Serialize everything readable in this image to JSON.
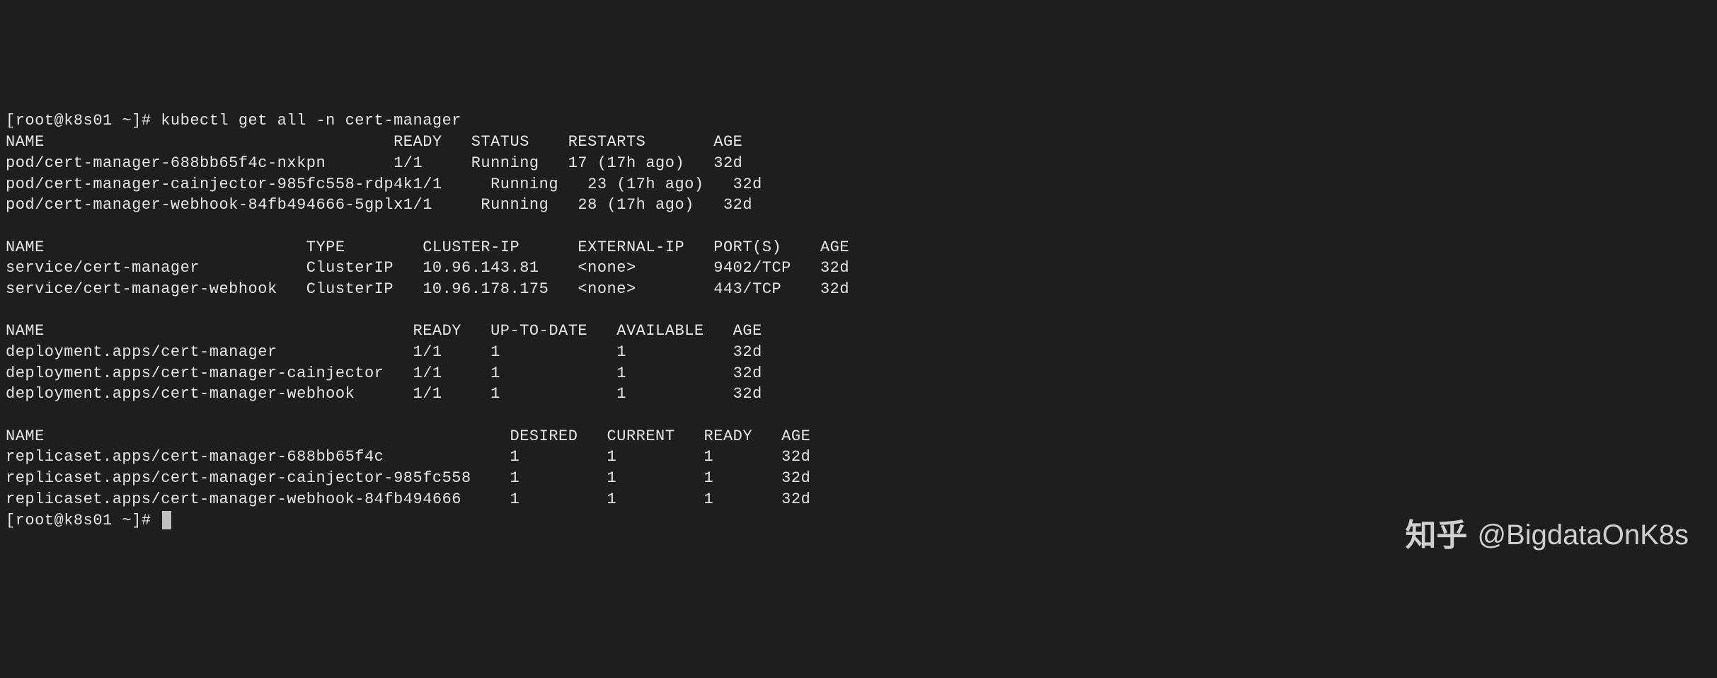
{
  "prompt1": "[root@k8s01 ~]# ",
  "command": "kubectl get all -n cert-manager",
  "pods": {
    "header": {
      "name": "NAME",
      "ready": "READY",
      "status": "STATUS",
      "restarts": "RESTARTS",
      "age": "AGE"
    },
    "rows": [
      {
        "name": "pod/cert-manager-688bb65f4c-nxkpn",
        "ready": "1/1",
        "status": "Running",
        "restarts": "17 (17h ago)",
        "age": "32d"
      },
      {
        "name": "pod/cert-manager-cainjector-985fc558-rdp4k",
        "ready": "1/1",
        "status": "Running",
        "restarts": "23 (17h ago)",
        "age": "32d"
      },
      {
        "name": "pod/cert-manager-webhook-84fb494666-5gplx",
        "ready": "1/1",
        "status": "Running",
        "restarts": "28 (17h ago)",
        "age": "32d"
      }
    ]
  },
  "services": {
    "header": {
      "name": "NAME",
      "type": "TYPE",
      "clusterip": "CLUSTER-IP",
      "externalip": "EXTERNAL-IP",
      "ports": "PORT(S)",
      "age": "AGE"
    },
    "rows": [
      {
        "name": "service/cert-manager",
        "type": "ClusterIP",
        "clusterip": "10.96.143.81",
        "externalip": "<none>",
        "ports": "9402/TCP",
        "age": "32d"
      },
      {
        "name": "service/cert-manager-webhook",
        "type": "ClusterIP",
        "clusterip": "10.96.178.175",
        "externalip": "<none>",
        "ports": "443/TCP",
        "age": "32d"
      }
    ]
  },
  "deployments": {
    "header": {
      "name": "NAME",
      "ready": "READY",
      "uptodate": "UP-TO-DATE",
      "available": "AVAILABLE",
      "age": "AGE"
    },
    "rows": [
      {
        "name": "deployment.apps/cert-manager",
        "ready": "1/1",
        "uptodate": "1",
        "available": "1",
        "age": "32d"
      },
      {
        "name": "deployment.apps/cert-manager-cainjector",
        "ready": "1/1",
        "uptodate": "1",
        "available": "1",
        "age": "32d"
      },
      {
        "name": "deployment.apps/cert-manager-webhook",
        "ready": "1/1",
        "uptodate": "1",
        "available": "1",
        "age": "32d"
      }
    ]
  },
  "replicasets": {
    "header": {
      "name": "NAME",
      "desired": "DESIRED",
      "current": "CURRENT",
      "ready": "READY",
      "age": "AGE"
    },
    "rows": [
      {
        "name": "replicaset.apps/cert-manager-688bb65f4c",
        "desired": "1",
        "current": "1",
        "ready": "1",
        "age": "32d"
      },
      {
        "name": "replicaset.apps/cert-manager-cainjector-985fc558",
        "desired": "1",
        "current": "1",
        "ready": "1",
        "age": "32d"
      },
      {
        "name": "replicaset.apps/cert-manager-webhook-84fb494666",
        "desired": "1",
        "current": "1",
        "ready": "1",
        "age": "32d"
      }
    ]
  },
  "prompt2": "[root@k8s01 ~]# ",
  "watermark": {
    "logo": "知乎",
    "handle": "@BigdataOnK8s"
  }
}
